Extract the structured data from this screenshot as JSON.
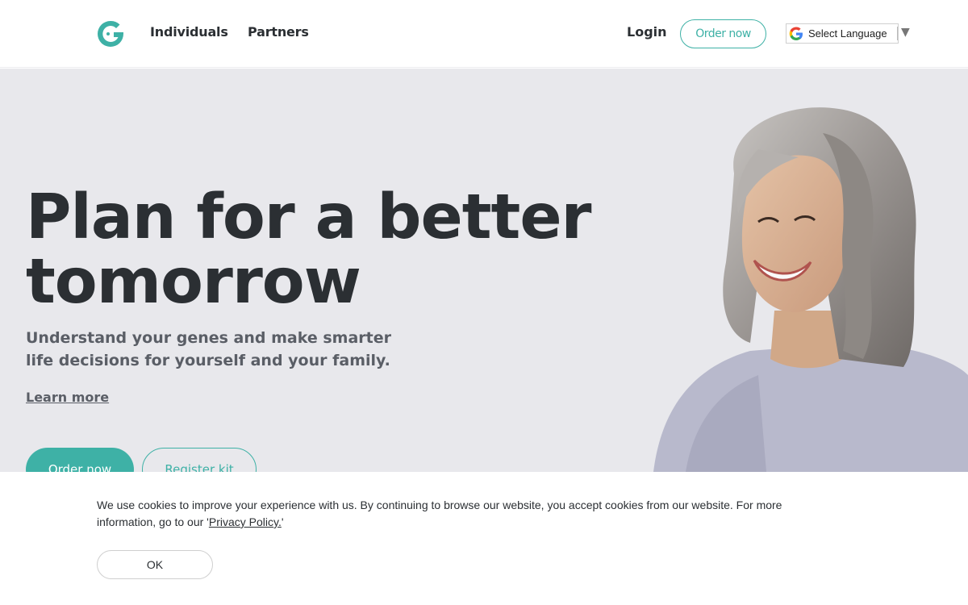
{
  "header": {
    "logo_icon": "genetic-g-logo-icon",
    "nav": [
      {
        "label": "Individuals"
      },
      {
        "label": "Partners"
      }
    ],
    "login_label": "Login",
    "order_label": "Order now",
    "language": {
      "label": "Select Language",
      "icon": "google-g-icon"
    }
  },
  "hero": {
    "title_line1": "Plan for a better",
    "title_line2": "tomorrow",
    "subtitle": "Understand your genes and make smarter life decisions for yourself and your family.",
    "learn_more": "Learn more",
    "order_button": "Order now",
    "register_button": "Register kit",
    "background_color": "#e8e8ec"
  },
  "cookie": {
    "text_before": "We use cookies to improve your experience with us. By continuing to browse our website, you accept cookies from our website. For more information, go to our '",
    "link": "Privacy Policy.",
    "text_after": "'",
    "ok_label": "OK"
  },
  "colors": {
    "accent": "#3eb1a6",
    "text_dark": "#2b2f33",
    "text_muted": "#5a5e66"
  }
}
